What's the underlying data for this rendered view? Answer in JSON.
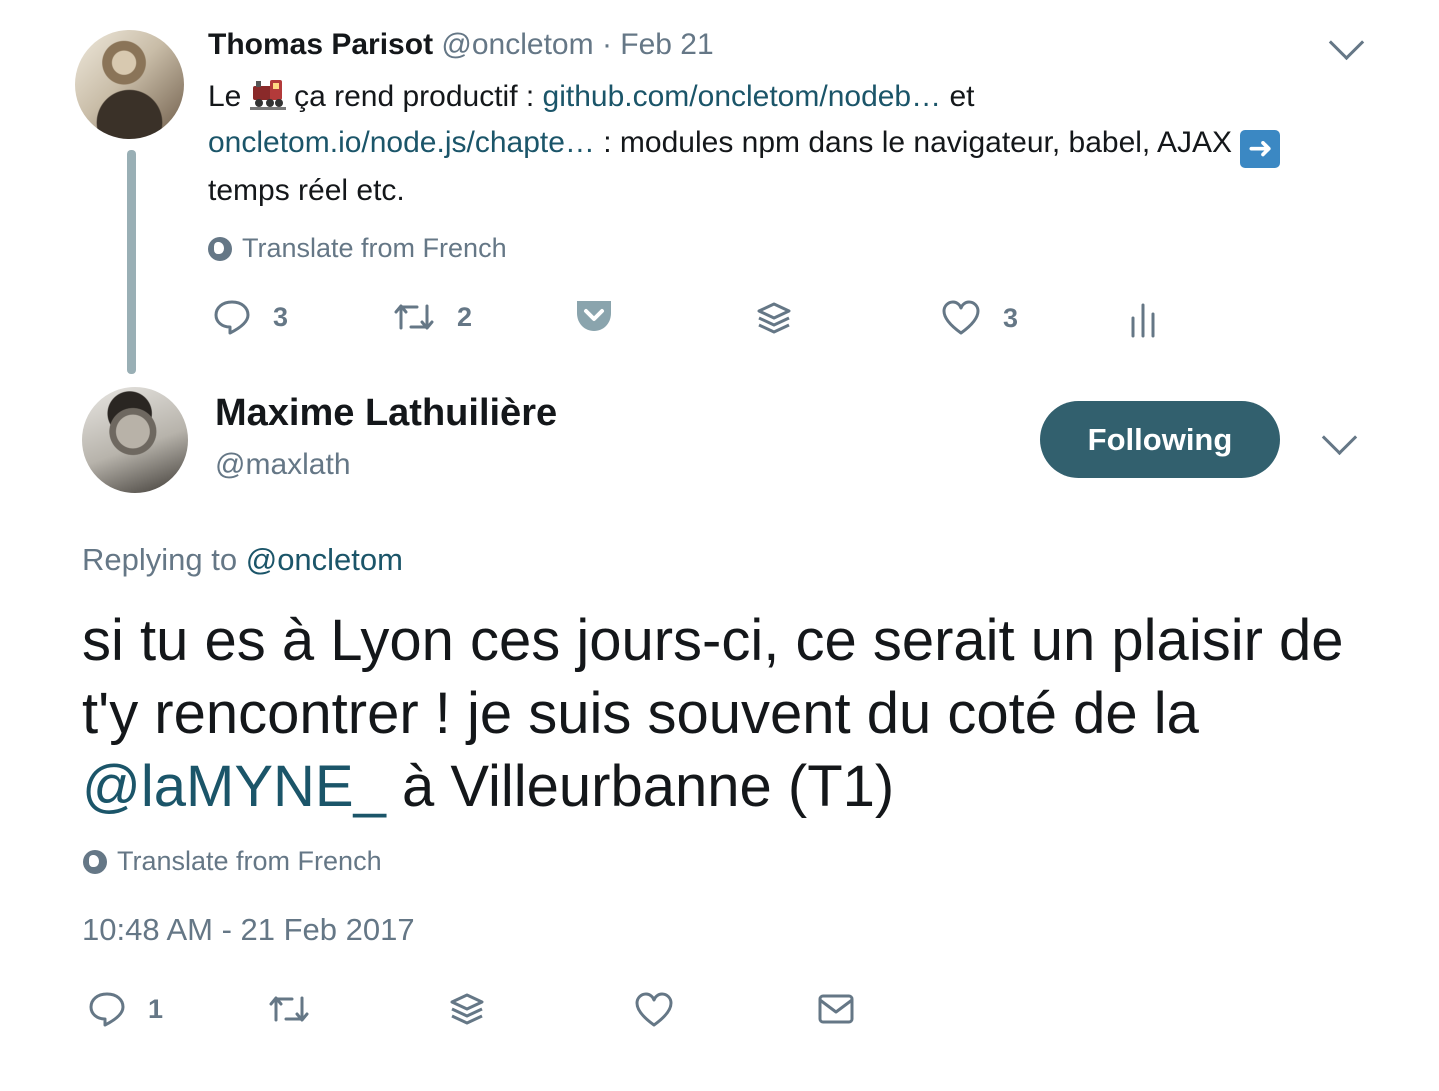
{
  "parent_tweet": {
    "author_name": "Thomas Parisot",
    "author_handle": "@oncletom",
    "date_sep": "·",
    "date": "Feb 21",
    "text_part1": "Le",
    "text_part2": "ça rend productif :",
    "link1": "github.com/oncletom/nodeb…",
    "text_part3": "et",
    "link2": "oncletom.io/node.js/chapte…",
    "text_part4": ": modules npm dans le navigateur, babel, AJAX",
    "text_part5": "temps réel etc.",
    "translate_label": "Translate from French",
    "actions": {
      "reply_count": "3",
      "retweet_count": "2",
      "like_count": "3"
    }
  },
  "main_tweet": {
    "author_name": "Maxime Lathuilière",
    "author_handle": "@maxlath",
    "follow_label": "Following",
    "replying_prefix": "Replying to",
    "replying_handle": "@oncletom",
    "text_part1": "si tu es à Lyon ces jours-ci, ce serait un plaisir de t'y rencontrer ! je suis souvent du coté de la",
    "mention": "@laMYNE_",
    "text_part2": "à Villeurbanne (T1)",
    "translate_label": "Translate from French",
    "timestamp": "10:48 AM - 21 Feb 2017",
    "actions": {
      "reply_count": "1"
    }
  },
  "colors": {
    "link": "#1b5569",
    "muted": "#657786",
    "follow_button": "#32606e",
    "thread_line": "#99afb5"
  },
  "icons": [
    "reply-icon",
    "retweet-icon",
    "pocket-icon",
    "buffer-icon",
    "like-icon",
    "analytics-icon",
    "dm-icon",
    "chevron-down-icon",
    "globe-icon",
    "train-emoji",
    "right-arrow-emoji"
  ]
}
